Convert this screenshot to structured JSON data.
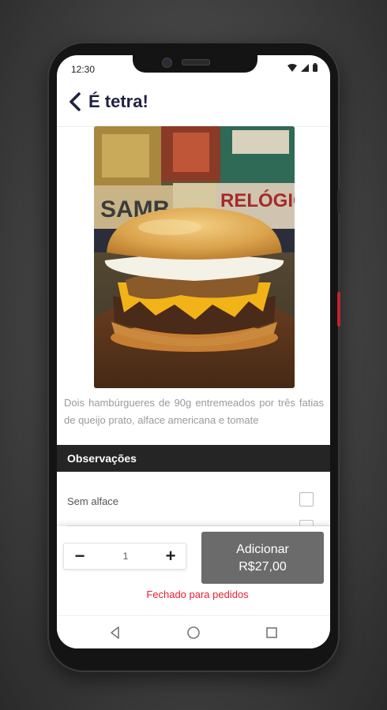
{
  "status_bar": {
    "time": "12:30"
  },
  "header": {
    "title": "É tetra!",
    "back_icon": "chevron-left-icon"
  },
  "product": {
    "image_alt": "Hambúrguer",
    "description": "Dois hambúrgueres de 90g entremeados por três fatias de queijo prato, alface americana e tomate"
  },
  "observations": {
    "title": "Observações",
    "options": [
      {
        "label": "Sem alface",
        "checked": false
      }
    ]
  },
  "order": {
    "minus_label": "−",
    "quantity": "1",
    "plus_label": "+",
    "add_label": "Adicionar",
    "add_price": "R$27,00",
    "closed_message": "Fechado para pedidos"
  },
  "navigation": {
    "back": "triangle-back-icon",
    "home": "circle-home-icon",
    "recents": "square-recents-icon"
  },
  "colors": {
    "accent": "#e8212f",
    "header_title": "#1f2240",
    "section_bar": "#252525",
    "button": "#6b6b6b"
  }
}
